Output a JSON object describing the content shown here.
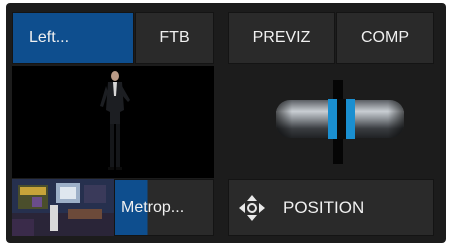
{
  "buttons": {
    "left": "Left...",
    "ftb": "FTB",
    "previz": "PREVIZ",
    "comp": "COMP",
    "metro": "Metrop...",
    "position": "POSITION"
  },
  "icons": {
    "position": "move-arrows-icon",
    "tbar": "tbar-slider-icon"
  },
  "transition": {
    "tbar_level": 0.5
  },
  "colors": {
    "accent": "#0e4e8e",
    "panel": "#1c1c1c",
    "button": "#2a2a2a",
    "tbar_highlight": "#1a8fd0"
  }
}
